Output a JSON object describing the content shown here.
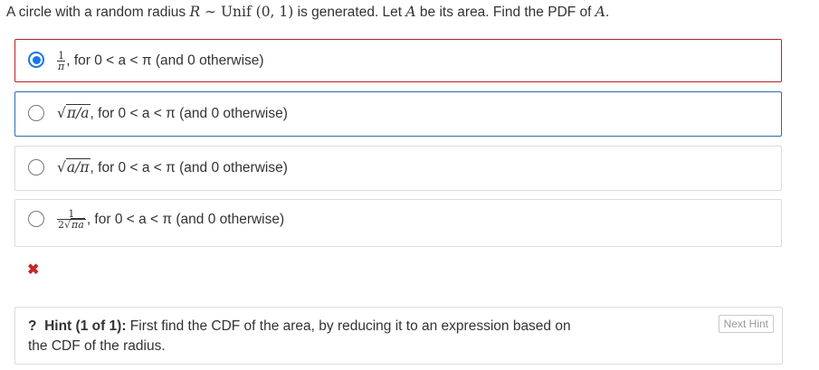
{
  "question": {
    "text_1": "A circle with a random radius ",
    "math_R": "R",
    "math_dist_1": " ∼ Unif",
    "math_dist_2": " (0, 1)",
    "text_2": " is generated. Let ",
    "math_A": "A",
    "text_3": " be its area. Find the PDF of ",
    "math_A2": "A",
    "text_4": "."
  },
  "options": [
    {
      "selected": true,
      "frac_num": "1",
      "frac_den": "π",
      "sep": ",",
      "text": " for 0 < a < π (and 0 otherwise)"
    },
    {
      "selected": false,
      "sqrt_body": "π/a",
      "sep": ",",
      "text": " for 0 < a < π (and 0 otherwise)"
    },
    {
      "selected": false,
      "sqrt_body": "a/π",
      "sep": ",",
      "text": " for 0 < a < π (and 0 otherwise)"
    },
    {
      "selected": false,
      "frac_num": "1",
      "frac_den_coef": "2",
      "frac_den_sqrt": "πa",
      "sep": ",",
      "text": " for 0 < a < π (and 0 otherwise)"
    }
  ],
  "feedback": {
    "wrong_mark": "✖"
  },
  "hint": {
    "icon": "?",
    "title": "Hint (1 of 1):",
    "text": " First find the CDF of the area, by reducing it to an expression based on the CDF of the radius.",
    "next_label": "Next Hint"
  },
  "colors": {
    "selected_border": "#b22222",
    "focused_border": "#2b6cb0",
    "radio_accent": "#1a73e8",
    "wrong": "#c62828"
  }
}
